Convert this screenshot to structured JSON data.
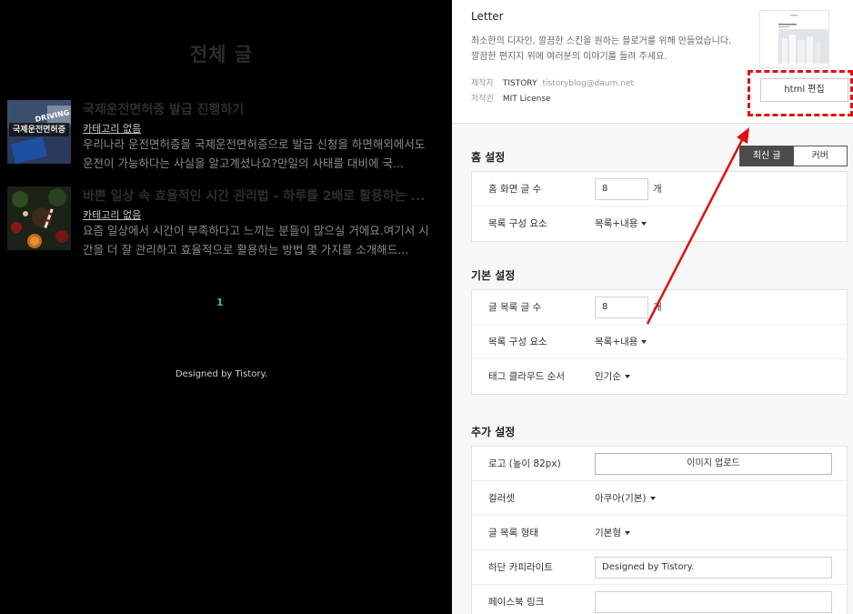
{
  "preview": {
    "page_title": "전체 글",
    "posts": [
      {
        "title": "국제운전면허증 발급 진행하기",
        "category": "카테고리 없음",
        "desc": "우리나라 운전면허증을 국제운전면허증으로 발급 신청을 하면해외에서도 운전이 가능하다는 사실을 알고계셨나요?만일의 사태를 대비에 국...",
        "thumb_text": "국제운전면허증",
        "thumb_badge": "DRIVING"
      },
      {
        "title": "바쁜 일상 속 효율적인 시간 관리법 - 하루를 2배로 활용하는 ...",
        "category": "카테고리 없음",
        "desc": "요즘 일상에서 시간이 부족하다고 느끼는 분들이 많으실 거에요.여기서 시간을 더 잘 관리하고 효율적으로 활용하는 방법 몇 가지를 소개해드..."
      }
    ],
    "page_number": "1",
    "footer": "Designed by Tistory."
  },
  "skin": {
    "name": "Letter",
    "desc_line1": "최소한의 디자인, 깔끔한 스킨을 원하는 블로거를 위해 만들었습니다.",
    "desc_line2": "깔끔한 편지지 위에 여러분의 이야기를 들려 주세요.",
    "maker_label": "제작자",
    "maker_value": "TISTORY",
    "maker_email": "tistoryblog@daum.net",
    "license_label": "저작권",
    "license_value": "MIT License",
    "html_edit_label": "html 편집"
  },
  "home_settings": {
    "title": "홈 설정",
    "toggle": [
      "최신 글",
      "커버"
    ],
    "toggle_selected": "최신 글",
    "rows": {
      "post_count_label": "홈 화면 글 수",
      "post_count_value": "8",
      "post_count_unit": "개",
      "list_comp_label": "목록 구성 요소",
      "list_comp_value": "목록+내용"
    }
  },
  "basic_settings": {
    "title": "기본 설정",
    "rows": {
      "list_count_label": "글 목록 글 수",
      "list_count_value": "8",
      "list_count_unit": "개",
      "list_comp_label": "목록 구성 요소",
      "list_comp_value": "목록+내용",
      "tag_order_label": "태그 클라우드 순서",
      "tag_order_value": "인기순"
    }
  },
  "extra_settings": {
    "title": "추가 설정",
    "rows": {
      "logo_label": "로고 (높이 82px)",
      "logo_button": "이미지 업로드",
      "colorset_label": "컬러셋",
      "colorset_value": "아쿠아(기본)",
      "list_type_label": "글 목록 형태",
      "list_type_value": "기본형",
      "copyright_label": "하단 카피라이트",
      "copyright_value": "Designed by Tistory.",
      "facebook_label": "페이스북 링크",
      "facebook_value": ""
    }
  },
  "colors": {
    "accent_red": "#e01010",
    "page_number": "#3ebca6",
    "toggle_on": "#4b4b4b"
  },
  "annotation_icons": [
    "dashed-highlight-box",
    "red-arrow"
  ]
}
